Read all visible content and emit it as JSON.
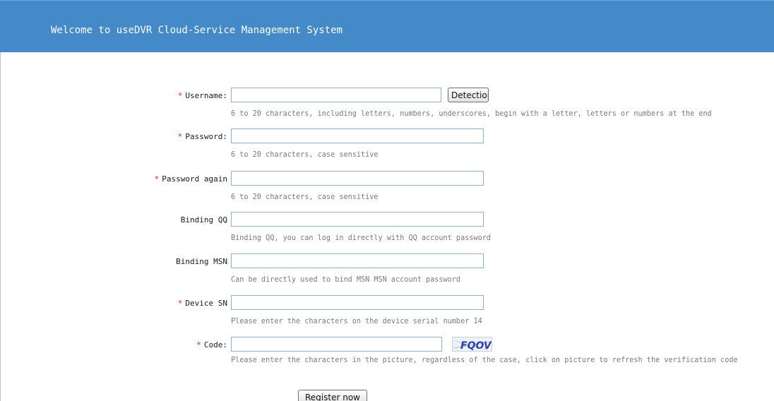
{
  "header": {
    "title": "Welcome to useDVR Cloud-Service Management System"
  },
  "required_marker": "*",
  "form": {
    "username": {
      "label": "Username:",
      "value": "",
      "hint": "6 to 20 characters, including letters, numbers, underscores, begin with a letter, letters or numbers at the end",
      "detect_button": "Detection"
    },
    "password": {
      "label": "Password:",
      "value": "",
      "hint": "6 to 20 characters, case sensitive"
    },
    "password_again": {
      "label": "Password again",
      "value": "",
      "hint": "6 to 20 characters, case sensitive"
    },
    "binding_qq": {
      "label": "Binding QQ",
      "value": "",
      "hint": "Binding QQ, you can log in directly with QQ account password"
    },
    "binding_msn": {
      "label": "Binding MSN",
      "value": "",
      "hint": "Can be directly used to bind MSN MSN account password"
    },
    "device_sn": {
      "label": "Device SN",
      "value": "",
      "hint": "Please enter the characters on the device serial number 14"
    },
    "code": {
      "label": "Code:",
      "value": "",
      "hint": "Please enter the characters in the picture, regardless of the case, click on picture to refresh the verification code",
      "captcha_text": "FQOV"
    },
    "submit_button": "Register now"
  }
}
